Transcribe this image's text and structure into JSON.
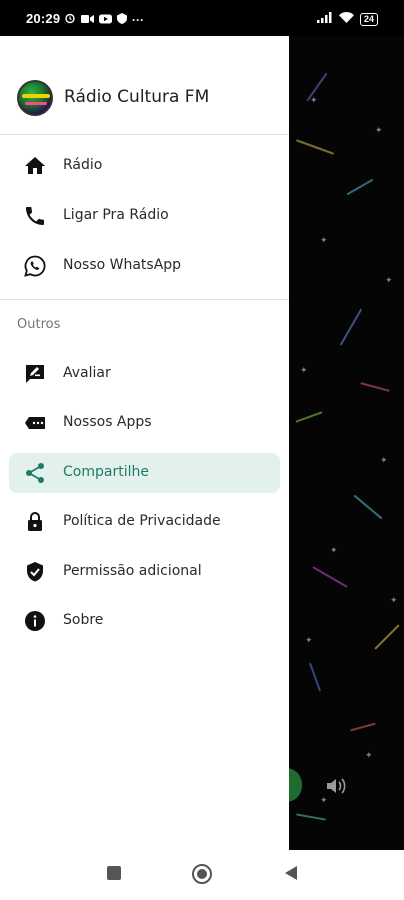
{
  "status_bar": {
    "time": "20:29",
    "battery": "24",
    "left_icons": [
      "alarm-icon",
      "video-icon",
      "youtube-icon",
      "shield-icon",
      "more-dots-icon"
    ],
    "right_icons": [
      "signal-icon",
      "wifi-icon",
      "battery-icon"
    ]
  },
  "drawer": {
    "app_title": "Rádio Cultura FM",
    "main_items": [
      {
        "label": "Rádio",
        "icon": "home-icon"
      },
      {
        "label": "Ligar Pra Rádio",
        "icon": "phone-icon"
      },
      {
        "label": "Nosso WhatsApp",
        "icon": "whatsapp-icon"
      }
    ],
    "section_title": "Outros",
    "other_items": [
      {
        "label": "Avaliar",
        "icon": "rate-review-icon"
      },
      {
        "label": "Nossos Apps",
        "icon": "ticket-apps-icon"
      },
      {
        "label": "Compartilhe",
        "icon": "share-icon",
        "active": true
      },
      {
        "label": "Política de Privacidade",
        "icon": "lock-icon"
      },
      {
        "label": "Permissão adicional",
        "icon": "verified-shield-icon"
      },
      {
        "label": "Sobre",
        "icon": "info-icon"
      }
    ]
  },
  "nav_bar": {
    "buttons": [
      "recents-square-icon",
      "home-circle-icon",
      "back-triangle-icon"
    ]
  },
  "colors": {
    "active_bg": "#e2f1ec",
    "active_fg": "#1e7a66",
    "scrim": "#000000"
  }
}
